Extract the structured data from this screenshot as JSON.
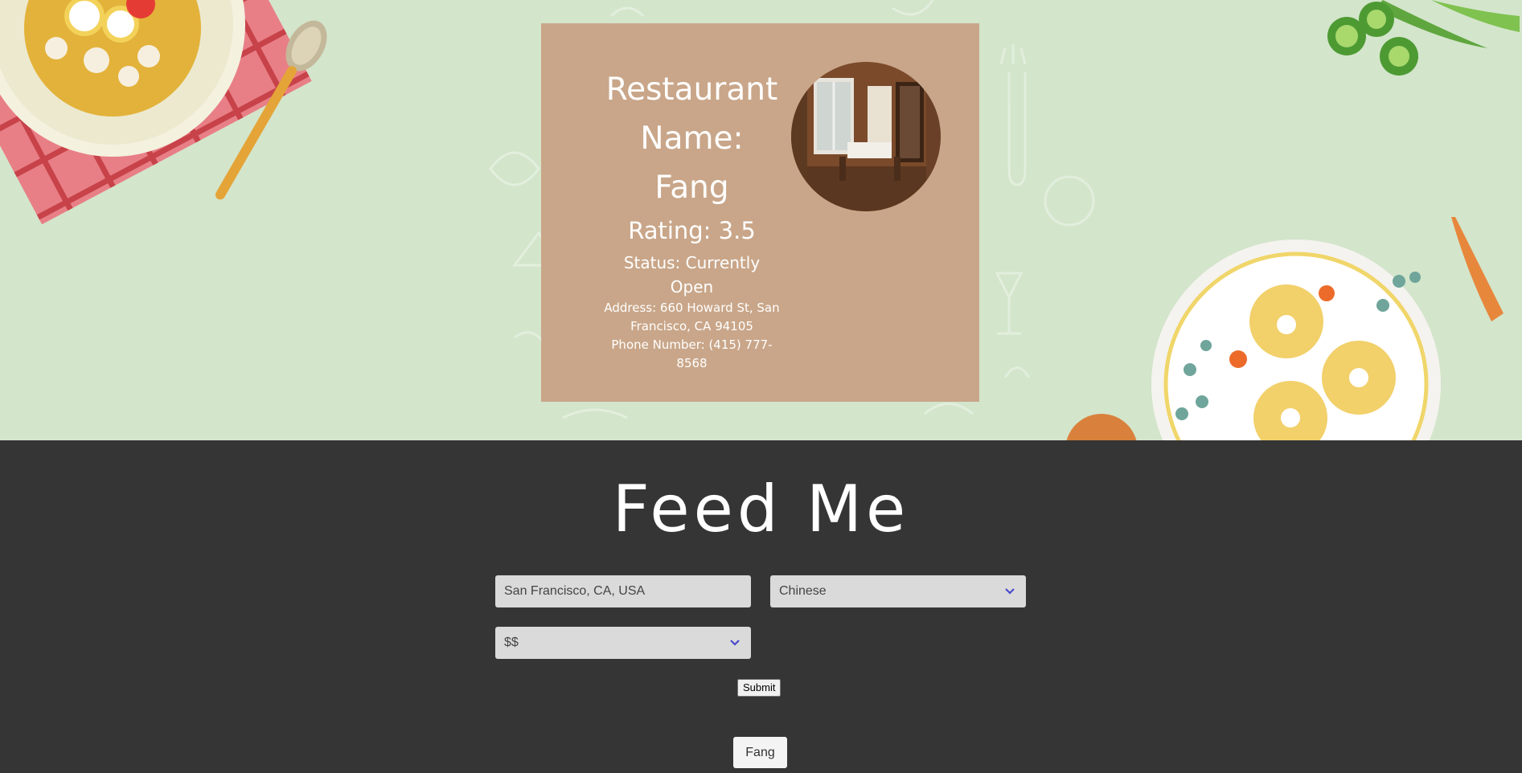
{
  "card": {
    "name_line1": "Restaurant",
    "name_line2": "Name:",
    "name_line3": "Fang",
    "rating": "Rating: 3.5",
    "status_line1": "Status: Currently",
    "status_line2": "Open",
    "address_line1": "Address: 660 Howard St, San",
    "address_line2": "Francisco, CA 94105",
    "phone_line1": "Phone Number: (415) 777-",
    "phone_line2": "8568"
  },
  "app": {
    "title": "Feed Me"
  },
  "form": {
    "location_value": "San Francisco, CA, USA",
    "cuisine_value": "Chinese",
    "price_value": "$$",
    "submit_label": "Submit"
  },
  "result": {
    "label": "Fang"
  },
  "colors": {
    "hero_bg": "#d3e5cb",
    "card_bg": "#c9a689",
    "dark_bg": "#353535",
    "field_bg": "#dadada",
    "chevron": "#4a4acb"
  },
  "icons": {
    "select_arrow": "chevron-down-icon"
  }
}
